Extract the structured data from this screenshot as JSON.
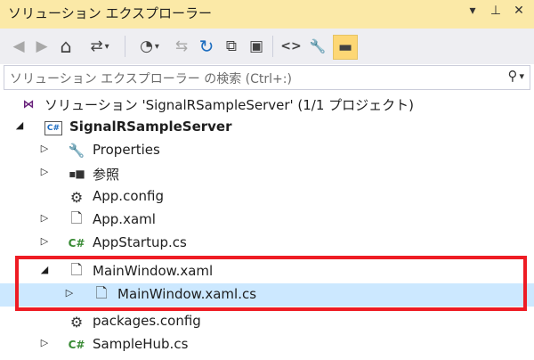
{
  "window": {
    "title": "ソリューション エクスプローラー",
    "controls": [
      "▾",
      "ᵖ",
      "✕"
    ]
  },
  "toolbar": {
    "back": "◀",
    "forward": "▶",
    "home": "⌂",
    "switch_views": "⇄",
    "dropdown": "▾",
    "pending_changes": "◔",
    "sync": "⇆",
    "refresh": "↻",
    "collapse_all": "⧉",
    "show_all_files": "▣",
    "view_code": "<>",
    "properties": "🔧",
    "preview": "▬"
  },
  "search": {
    "placeholder": "ソリューション エクスプローラー の検索 (Ctrl+:)",
    "icon": "⚲",
    "dropdown": "▾"
  },
  "tree": {
    "solution": "ソリューション 'SignalRSampleServer' (1/1 プロジェクト)",
    "project": "SignalRSampleServer",
    "items": [
      {
        "label": "Properties",
        "icon": "wrench-icon"
      },
      {
        "label": "参照",
        "icon": "references-icon"
      },
      {
        "label": "App.config",
        "icon": "config-file-icon"
      },
      {
        "label": "App.xaml",
        "icon": "xaml-file-icon"
      },
      {
        "label": "AppStartup.cs",
        "icon": "csharp-file-icon"
      },
      {
        "label": "MainWindow.xaml",
        "icon": "xaml-file-icon"
      },
      {
        "label": "MainWindow.xaml.cs",
        "icon": "csharp-code-file-icon"
      },
      {
        "label": "packages.config",
        "icon": "config-file-icon"
      },
      {
        "label": "SampleHub.cs",
        "icon": "csharp-file-icon"
      }
    ],
    "icons": {
      "solution": "⋈",
      "project": "C#",
      "wrench": "🔧",
      "references": "▪■",
      "file": "🗋",
      "config": "⚙",
      "cs": "C#"
    },
    "arrows": {
      "expanded": "◢",
      "collapsed": "▷"
    }
  },
  "colors": {
    "title_bg": "#fbe9a7",
    "toolbar_bg": "#eeeef2",
    "selected_bg": "#cce8ff",
    "highlight": "#ee1c24"
  }
}
